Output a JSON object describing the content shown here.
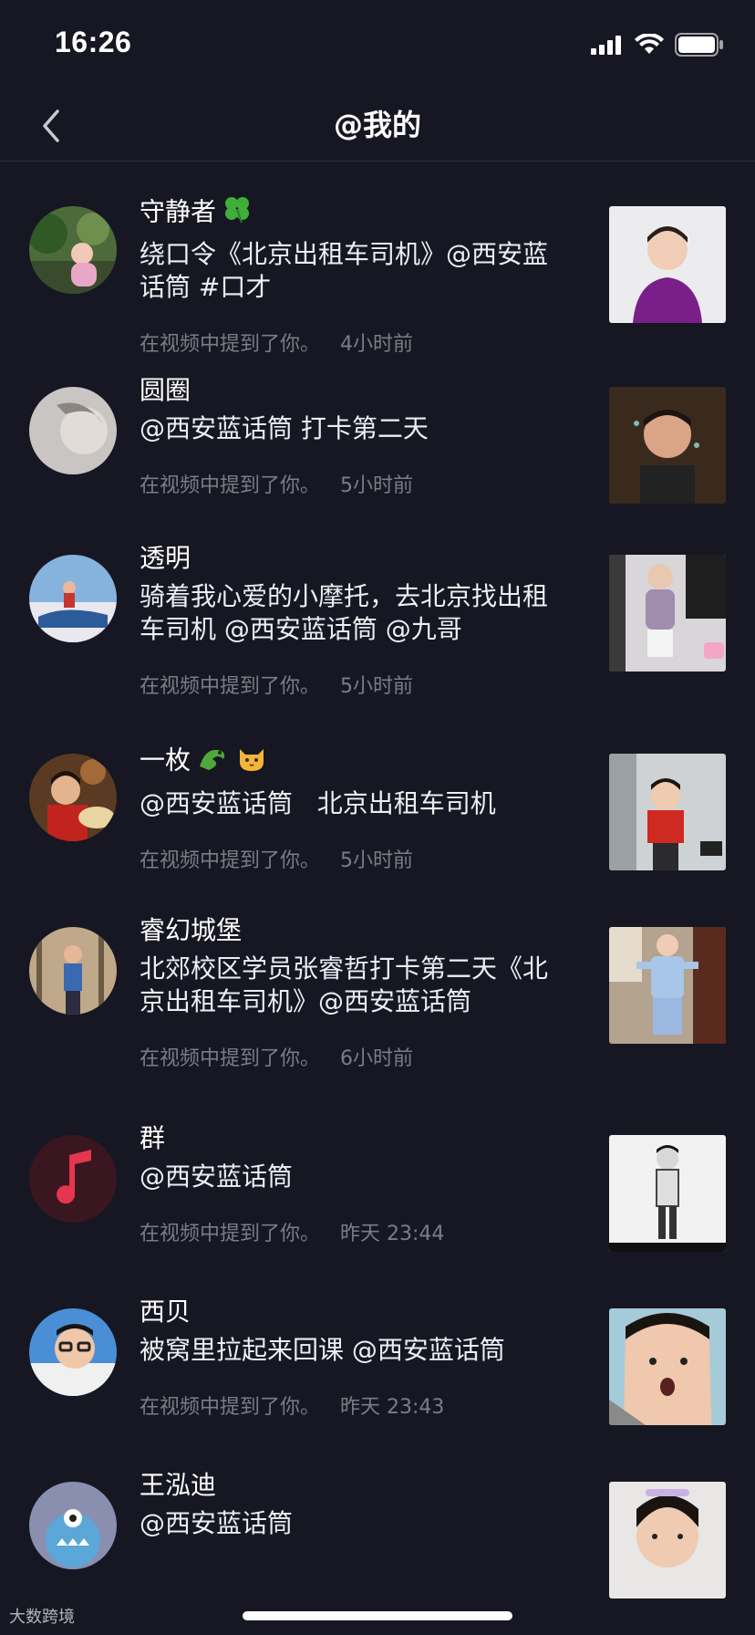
{
  "status_bar": {
    "time": "16:26"
  },
  "nav": {
    "title": "@我的",
    "back_icon": "chevron-left-icon"
  },
  "items": [
    {
      "name": "守静者",
      "name_emoji": "four-leaf-clover-icon",
      "text": "绕口令《北京出租车司机》@西安蓝话筒 #口才",
      "action": "在视频中提到了你。",
      "time": "4小时前"
    },
    {
      "name": "圆圈",
      "text": "@西安蓝话筒 打卡第二天",
      "action": "在视频中提到了你。",
      "time": "5小时前"
    },
    {
      "name": "透明",
      "text": "骑着我心爱的小摩托，去北京找出租车司机 @西安蓝话筒 @九哥",
      "action": "在视频中提到了你。",
      "time": "5小时前"
    },
    {
      "name": "一枚",
      "name_emoji": "dragon-cat-icons",
      "text": "@西安蓝话筒   北京出租车司机",
      "action": "在视频中提到了你。",
      "time": "5小时前"
    },
    {
      "name": "睿幻城堡",
      "text": "北郊校区学员张睿哲打卡第二天《北京出租车司机》@西安蓝话筒",
      "action": "在视频中提到了你。",
      "time": "6小时前"
    },
    {
      "name": "群",
      "text": "@西安蓝话筒",
      "action": "在视频中提到了你。",
      "time": "昨天 23:44"
    },
    {
      "name": "西贝",
      "text": "被窝里拉起来回课 @西安蓝话筒",
      "action": "在视频中提到了你。",
      "time": "昨天 23:43"
    },
    {
      "name": "王泓迪",
      "text": "@西安蓝话筒"
    }
  ],
  "watermark": "大数跨境"
}
